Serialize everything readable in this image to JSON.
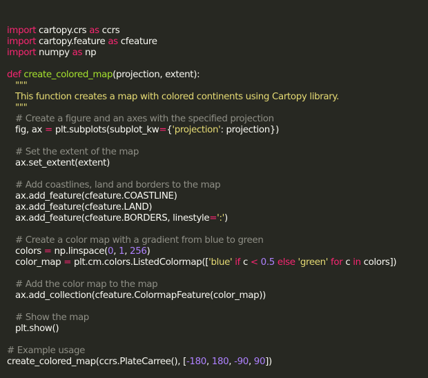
{
  "colors": {
    "background": "#272822",
    "default": "#f8f8f2",
    "keyword": "#f92672",
    "function": "#a6e22e",
    "string": "#e6db74",
    "number": "#ae81ff",
    "comment": "#8f8f86"
  },
  "code": {
    "lines": [
      {
        "indent": 0,
        "tokens": [
          {
            "t": "import",
            "k": "kw"
          },
          {
            "t": " cartopy.crs ",
            "k": "pl"
          },
          {
            "t": "as",
            "k": "kw"
          },
          {
            "t": " ccrs",
            "k": "pl"
          }
        ]
      },
      {
        "indent": 0,
        "tokens": [
          {
            "t": "import",
            "k": "kw"
          },
          {
            "t": " cartopy.feature ",
            "k": "pl"
          },
          {
            "t": "as",
            "k": "kw"
          },
          {
            "t": " cfeature",
            "k": "pl"
          }
        ]
      },
      {
        "indent": 0,
        "tokens": [
          {
            "t": "import",
            "k": "kw"
          },
          {
            "t": " numpy ",
            "k": "pl"
          },
          {
            "t": "as",
            "k": "kw"
          },
          {
            "t": " np",
            "k": "pl"
          }
        ]
      },
      {
        "indent": 0,
        "tokens": []
      },
      {
        "indent": 0,
        "tokens": [
          {
            "t": "def",
            "k": "kw"
          },
          {
            "t": " ",
            "k": "pl"
          },
          {
            "t": "create_colored_map",
            "k": "fn"
          },
          {
            "t": "(projection, extent):",
            "k": "pl"
          }
        ]
      },
      {
        "indent": 1,
        "tokens": [
          {
            "t": "\"\"\"",
            "k": "str"
          }
        ]
      },
      {
        "indent": 1,
        "tokens": [
          {
            "t": "This function creates a map with colored continents using Cartopy library.",
            "k": "str"
          }
        ]
      },
      {
        "indent": 1,
        "tokens": [
          {
            "t": "\"\"\"",
            "k": "str"
          }
        ]
      },
      {
        "indent": 1,
        "tokens": [
          {
            "t": "# Create a figure and an axes with the specified projection",
            "k": "cm"
          }
        ]
      },
      {
        "indent": 1,
        "tokens": [
          {
            "t": "fig, ax ",
            "k": "pl"
          },
          {
            "t": "=",
            "k": "op"
          },
          {
            "t": " plt.subplots(subplot_kw",
            "k": "pl"
          },
          {
            "t": "=",
            "k": "op"
          },
          {
            "t": "{",
            "k": "pl"
          },
          {
            "t": "'projection'",
            "k": "str"
          },
          {
            "t": ": projection})",
            "k": "pl"
          }
        ]
      },
      {
        "indent": 0,
        "tokens": []
      },
      {
        "indent": 1,
        "tokens": [
          {
            "t": "# Set the extent of the map",
            "k": "cm"
          }
        ]
      },
      {
        "indent": 1,
        "tokens": [
          {
            "t": "ax.set_extent(extent)",
            "k": "pl"
          }
        ]
      },
      {
        "indent": 0,
        "tokens": []
      },
      {
        "indent": 1,
        "tokens": [
          {
            "t": "# Add coastlines, land and borders to the map",
            "k": "cm"
          }
        ]
      },
      {
        "indent": 1,
        "tokens": [
          {
            "t": "ax.add_feature(cfeature.COASTLINE)",
            "k": "pl"
          }
        ]
      },
      {
        "indent": 1,
        "tokens": [
          {
            "t": "ax.add_feature(cfeature.LAND)",
            "k": "pl"
          }
        ]
      },
      {
        "indent": 1,
        "tokens": [
          {
            "t": "ax.add_feature(cfeature.BORDERS, linestyle",
            "k": "pl"
          },
          {
            "t": "=",
            "k": "op"
          },
          {
            "t": "':'",
            "k": "str"
          },
          {
            "t": ")",
            "k": "pl"
          }
        ]
      },
      {
        "indent": 0,
        "tokens": []
      },
      {
        "indent": 1,
        "tokens": [
          {
            "t": "# Create a color map with a gradient from blue to green",
            "k": "cm"
          }
        ]
      },
      {
        "indent": 1,
        "tokens": [
          {
            "t": "colors ",
            "k": "pl"
          },
          {
            "t": "=",
            "k": "op"
          },
          {
            "t": " np.linspace(",
            "k": "pl"
          },
          {
            "t": "0",
            "k": "num"
          },
          {
            "t": ", ",
            "k": "pl"
          },
          {
            "t": "1",
            "k": "num"
          },
          {
            "t": ", ",
            "k": "pl"
          },
          {
            "t": "256",
            "k": "num"
          },
          {
            "t": ")",
            "k": "pl"
          }
        ]
      },
      {
        "indent": 1,
        "tokens": [
          {
            "t": "color_map ",
            "k": "pl"
          },
          {
            "t": "=",
            "k": "op"
          },
          {
            "t": " plt.cm.colors.ListedColormap([",
            "k": "pl"
          },
          {
            "t": "'blue'",
            "k": "str"
          },
          {
            "t": " ",
            "k": "pl"
          },
          {
            "t": "if",
            "k": "kw"
          },
          {
            "t": " c ",
            "k": "pl"
          },
          {
            "t": "<",
            "k": "op"
          },
          {
            "t": " ",
            "k": "pl"
          },
          {
            "t": "0.5",
            "k": "num"
          },
          {
            "t": " ",
            "k": "pl"
          },
          {
            "t": "else",
            "k": "kw"
          },
          {
            "t": " ",
            "k": "pl"
          },
          {
            "t": "'green'",
            "k": "str"
          },
          {
            "t": " ",
            "k": "pl"
          },
          {
            "t": "for",
            "k": "kw"
          },
          {
            "t": " c ",
            "k": "pl"
          },
          {
            "t": "in",
            "k": "kw"
          },
          {
            "t": " colors])",
            "k": "pl"
          }
        ]
      },
      {
        "indent": 0,
        "tokens": []
      },
      {
        "indent": 1,
        "tokens": [
          {
            "t": "# Add the color map to the map",
            "k": "cm"
          }
        ]
      },
      {
        "indent": 1,
        "tokens": [
          {
            "t": "ax.add_collection(cfeature.ColormapFeature(color_map))",
            "k": "pl"
          }
        ]
      },
      {
        "indent": 0,
        "tokens": []
      },
      {
        "indent": 1,
        "tokens": [
          {
            "t": "# Show the map",
            "k": "cm"
          }
        ]
      },
      {
        "indent": 1,
        "tokens": [
          {
            "t": "plt.show()",
            "k": "pl"
          }
        ]
      },
      {
        "indent": 0,
        "tokens": []
      },
      {
        "indent": 0,
        "tokens": [
          {
            "t": "# Example usage",
            "k": "cm"
          }
        ]
      },
      {
        "indent": 0,
        "tokens": [
          {
            "t": "create_colored_map(ccrs.PlateCarree(), [",
            "k": "pl"
          },
          {
            "t": "-180",
            "k": "num"
          },
          {
            "t": ", ",
            "k": "pl"
          },
          {
            "t": "180",
            "k": "num"
          },
          {
            "t": ", ",
            "k": "pl"
          },
          {
            "t": "-90",
            "k": "num"
          },
          {
            "t": ", ",
            "k": "pl"
          },
          {
            "t": "90",
            "k": "num"
          },
          {
            "t": "])",
            "k": "pl"
          }
        ]
      }
    ]
  }
}
